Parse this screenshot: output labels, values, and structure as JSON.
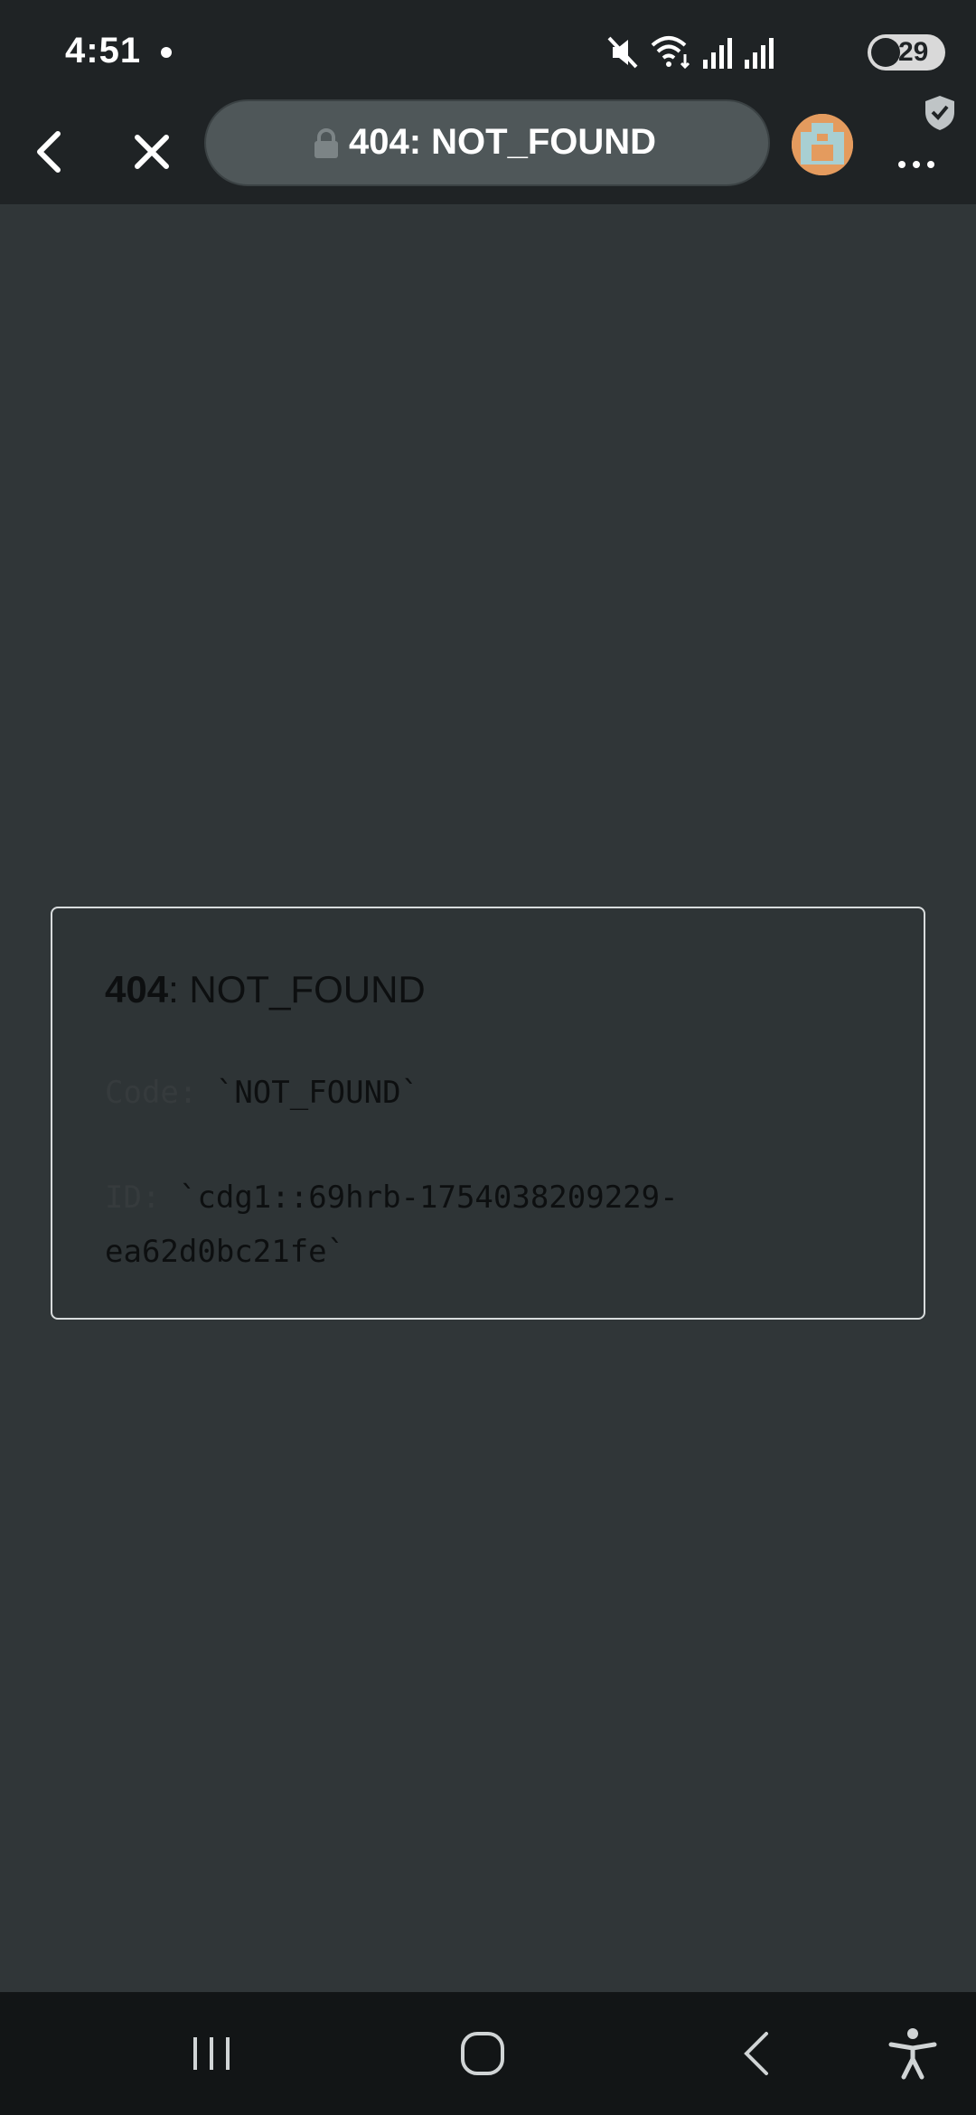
{
  "status_bar": {
    "time": "4:51",
    "battery": "29",
    "icons": [
      "mute-icon",
      "wifi-icon",
      "signal-icon",
      "signal-icon"
    ]
  },
  "toolbar": {
    "page_title": "404: NOT_FOUND",
    "icons": [
      "back-icon",
      "close-icon",
      "lock-icon",
      "avatar",
      "shield-check-icon",
      "more-icon"
    ]
  },
  "error": {
    "code_number": "404",
    "code_text": ": NOT_FOUND",
    "code_label": "Code:",
    "code_value": "`NOT_FOUND`",
    "id_label": "ID:",
    "id_value_line1": "`cdg1::69hrb-1754038209229-",
    "id_value_line2": "ea62d0bc21fe`"
  },
  "nav_bar": {
    "icons": [
      "recent-apps-icon",
      "home-icon",
      "back-nav-icon",
      "accessibility-icon"
    ]
  },
  "colors": {
    "page_bg": "#303638",
    "chrome_bg": "#1f2325",
    "nav_bg": "#121516",
    "pill_bg": "#4f5759",
    "card_border": "#d8dcdd",
    "avatar_bg": "#e49b5e",
    "avatar_face": "#a8cfd2"
  }
}
